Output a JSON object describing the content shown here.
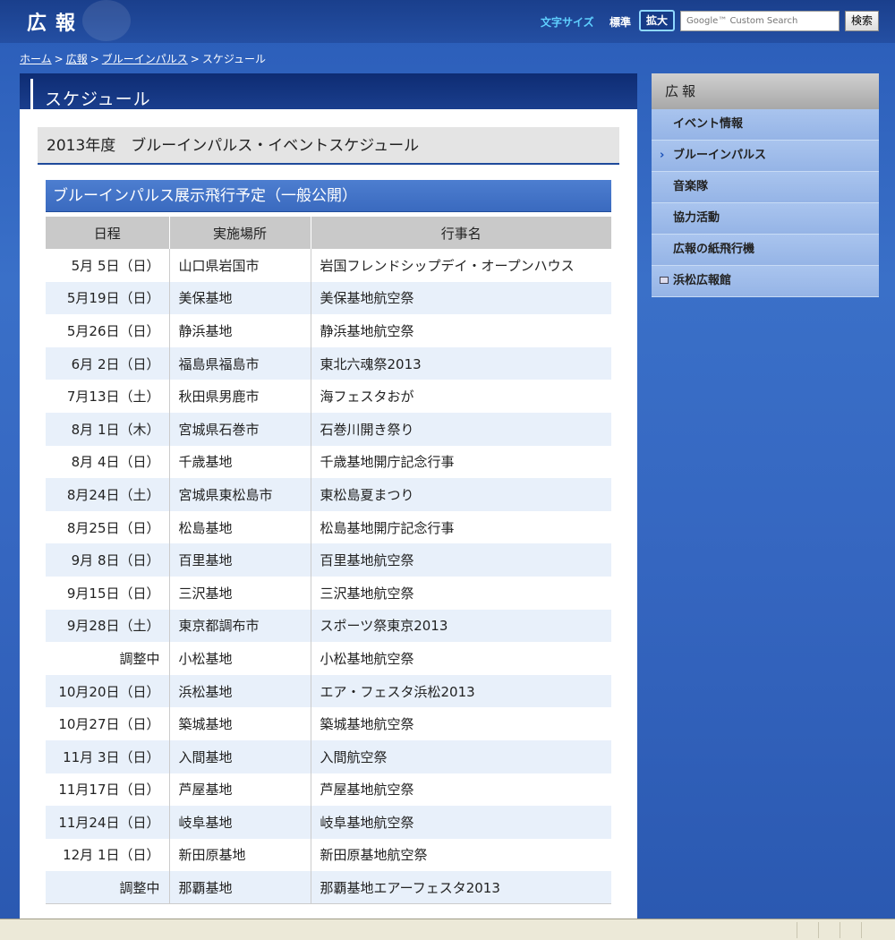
{
  "header": {
    "site_title": "広報",
    "font_size_label": "文字サイズ",
    "size_standard": "標準",
    "size_large": "拡大",
    "search_placeholder": "Google™ Custom Search",
    "search_button": "検索"
  },
  "breadcrumb": {
    "home": "ホーム",
    "koho": "広報",
    "blue_impulse": "ブルーインパルス",
    "current": "スケジュール",
    "sep": ">"
  },
  "main": {
    "title": "スケジュール",
    "section_title": "2013年度　ブルーインパルス・イベントスケジュール",
    "sub_title": "ブルーインパルス展示飛行予定（一般公開）",
    "table": {
      "headers": [
        "日程",
        "実施場所",
        "行事名"
      ],
      "rows": [
        [
          "5月 5日（日）",
          "山口県岩国市",
          "岩国フレンドシップデイ・オープンハウス"
        ],
        [
          "5月19日（日）",
          "美保基地",
          "美保基地航空祭"
        ],
        [
          "5月26日（日）",
          "静浜基地",
          "静浜基地航空祭"
        ],
        [
          "6月 2日（日）",
          "福島県福島市",
          "東北六魂祭2013"
        ],
        [
          "7月13日（土）",
          "秋田県男鹿市",
          "海フェスタおが"
        ],
        [
          "8月 1日（木）",
          "宮城県石巻市",
          "石巻川開き祭り"
        ],
        [
          "8月 4日（日）",
          "千歳基地",
          "千歳基地開庁記念行事"
        ],
        [
          "8月24日（土）",
          "宮城県東松島市",
          "東松島夏まつり"
        ],
        [
          "8月25日（日）",
          "松島基地",
          "松島基地開庁記念行事"
        ],
        [
          "9月 8日（日）",
          "百里基地",
          "百里基地航空祭"
        ],
        [
          "9月15日（日）",
          "三沢基地",
          "三沢基地航空祭"
        ],
        [
          "9月28日（土）",
          "東京都調布市",
          "スポーツ祭東京2013"
        ],
        [
          "調整中",
          "小松基地",
          "小松基地航空祭"
        ],
        [
          "10月20日（日）",
          "浜松基地",
          "エア・フェスタ浜松2013"
        ],
        [
          "10月27日（日）",
          "築城基地",
          "築城基地航空祭"
        ],
        [
          "11月 3日（日）",
          "入間基地",
          "入間航空祭"
        ],
        [
          "11月17日（日）",
          "芦屋基地",
          "芦屋基地航空祭"
        ],
        [
          "11月24日（日）",
          "岐阜基地",
          "岐阜基地航空祭"
        ],
        [
          "12月 1日（日）",
          "新田原基地",
          "新田原基地航空祭"
        ],
        [
          "調整中",
          "那覇基地",
          "那覇基地エアーフェスタ2013"
        ]
      ]
    }
  },
  "sidebar": {
    "title": "広報",
    "items": [
      {
        "label": "イベント情報"
      },
      {
        "label": "ブルーインパルス",
        "marker": "›"
      },
      {
        "label": "音楽隊"
      },
      {
        "label": "協力活動"
      },
      {
        "label": "広報の紙飛行機"
      },
      {
        "label": "浜松広報館"
      }
    ]
  },
  "colors": {
    "header_bg": "#1a3f8c",
    "accent_cyan": "#5fd0ff",
    "row_alt": "#e8f0fa",
    "subhead_bg": "#4d7ed0"
  }
}
